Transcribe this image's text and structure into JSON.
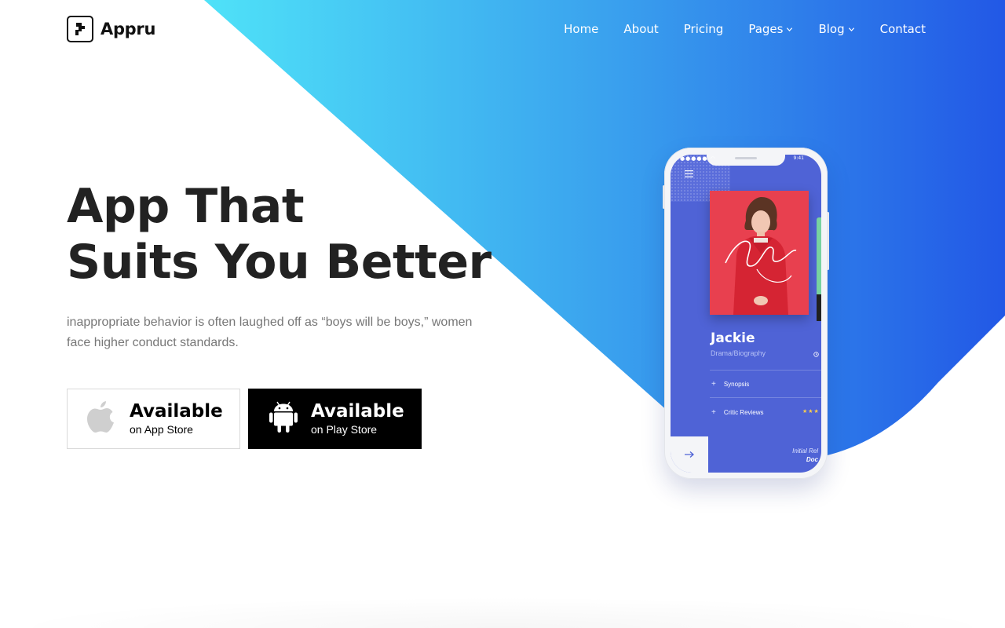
{
  "brand": {
    "name": "Appru",
    "icon": "logo-mark-icon"
  },
  "nav": {
    "items": [
      {
        "label": "Home",
        "has_dropdown": false
      },
      {
        "label": "About",
        "has_dropdown": false
      },
      {
        "label": "Pricing",
        "has_dropdown": false
      },
      {
        "label": "Pages",
        "has_dropdown": true
      },
      {
        "label": "Blog",
        "has_dropdown": true
      },
      {
        "label": "Contact",
        "has_dropdown": false
      }
    ]
  },
  "hero": {
    "title_line1": "App That",
    "title_line2": "Suits You Better",
    "description": "inappropriate behavior is often laughed off as “boys will be boys,” women face higher conduct standards."
  },
  "store_buttons": {
    "apple": {
      "title": "Available",
      "subtitle": "on App Store",
      "icon": "apple-icon"
    },
    "android": {
      "title": "Available",
      "subtitle": "on Play Store",
      "icon": "android-icon"
    }
  },
  "phone_screen": {
    "status_time": "9:41",
    "movie_title": "Jackie",
    "movie_genre": "Drama/Biography",
    "poster_script": "Jackie",
    "rows": [
      {
        "label": "Synopsis"
      },
      {
        "label": "Critic Reviews"
      }
    ],
    "rating_stars": "★★★",
    "footer_line1": "Initial Rel",
    "footer_line2": "Doc"
  },
  "colors": {
    "gradient_start": "#4fe0f7",
    "gradient_end": "#2256e6",
    "text_dark": "#222222",
    "text_muted": "#777777",
    "phone_screen": "#4f63d6",
    "poster_red": "#e8404f"
  }
}
